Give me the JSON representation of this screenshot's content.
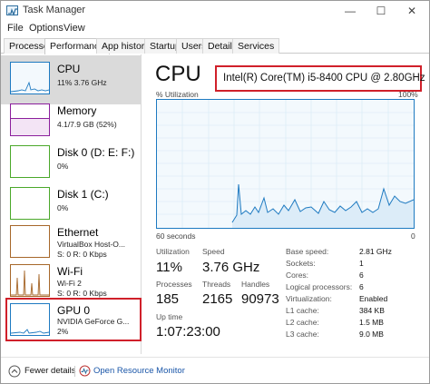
{
  "window": {
    "title": "Task Manager",
    "min_glyph": "—",
    "max_glyph": "☐",
    "close_glyph": "✕"
  },
  "menu": [
    "File",
    "Options",
    "View"
  ],
  "tabs": [
    "Processes",
    "Performance",
    "App history",
    "Startup",
    "Users",
    "Details",
    "Services"
  ],
  "active_tab": "Performance",
  "sidebar": [
    {
      "name": "CPU",
      "line1": "11% 3.76 GHz",
      "line2": "",
      "color": "#1e7ac1",
      "selected": true
    },
    {
      "name": "Memory",
      "line1": "4.1/7.9 GB (52%)",
      "line2": "",
      "color": "#8b1e9c",
      "selected": false
    },
    {
      "name": "Disk 0 (D: E: F:)",
      "line1": "0%",
      "line2": "",
      "color": "#4aa82a",
      "selected": false
    },
    {
      "name": "Disk 1 (C:)",
      "line1": "0%",
      "line2": "",
      "color": "#4aa82a",
      "selected": false
    },
    {
      "name": "Ethernet",
      "line1": "VirtualBox Host-O...",
      "line2": "S: 0 R: 0 Kbps",
      "color": "#a6672a",
      "selected": false
    },
    {
      "name": "Wi-Fi",
      "line1": "Wi-Fi 2",
      "line2": "S: 0 R: 0 Kbps",
      "color": "#a6672a",
      "selected": false
    },
    {
      "name": "GPU 0",
      "line1": "NVIDIA GeForce G...",
      "line2": "2%",
      "color": "#1e7ac1",
      "selected": false
    }
  ],
  "main": {
    "title": "CPU",
    "model": "Intel(R) Core(TM) i5-8400 CPU @ 2.80GHz",
    "graph": {
      "top_left": "% Utilization",
      "top_right": "100%",
      "bottom_left": "60 seconds",
      "bottom_right": "0"
    },
    "stats": [
      {
        "label": "Utilization",
        "value": "11%"
      },
      {
        "label": "Speed",
        "value": "3.76 GHz"
      },
      {
        "label": "Processes",
        "value": "185"
      },
      {
        "label": "Threads",
        "value": "2165"
      },
      {
        "label": "Handles",
        "value": "90973"
      },
      {
        "label": "Up time",
        "value": "1:07:23:00"
      }
    ],
    "details": [
      {
        "key": "Base speed:",
        "value": "2.81 GHz"
      },
      {
        "key": "Sockets:",
        "value": "1"
      },
      {
        "key": "Cores:",
        "value": "6"
      },
      {
        "key": "Logical processors:",
        "value": "6"
      },
      {
        "key": "Virtualization:",
        "value": "Enabled"
      },
      {
        "key": "L1 cache:",
        "value": "384 KB"
      },
      {
        "key": "L2 cache:",
        "value": "1.5 MB"
      },
      {
        "key": "L3 cache:",
        "value": "9.0 MB"
      }
    ]
  },
  "footer": {
    "fewer_details": "Fewer details",
    "open_monitor": "Open Resource Monitor"
  },
  "colors": {
    "accent": "#1e7ac1",
    "highlight": "#d0202a",
    "link": "#1a56a8"
  }
}
